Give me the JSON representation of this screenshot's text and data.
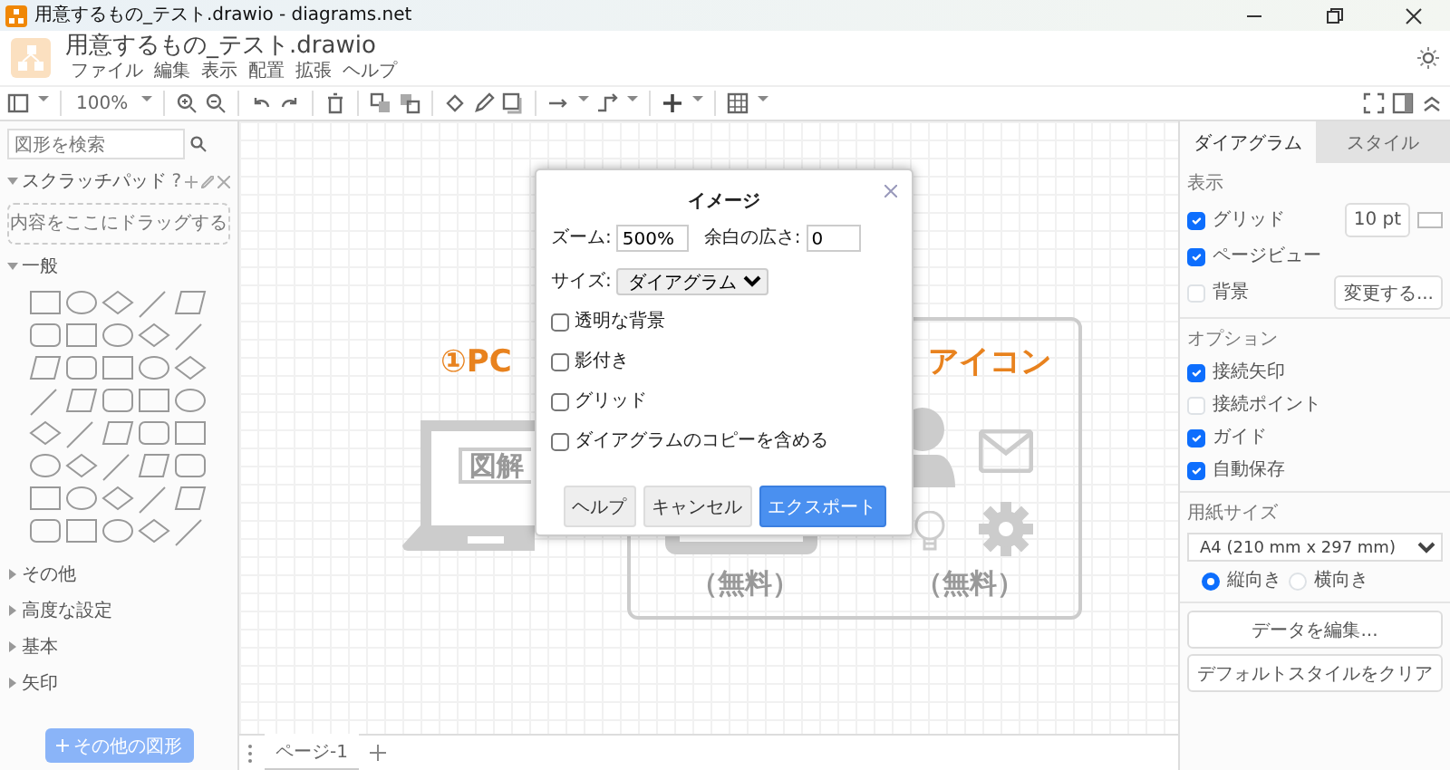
{
  "window": {
    "title": "用意するもの_テスト.drawio - diagrams.net"
  },
  "header": {
    "file_name": "用意するもの_テスト.drawio",
    "menu": [
      "ファイル",
      "編集",
      "表示",
      "配置",
      "拡張",
      "ヘルプ"
    ]
  },
  "toolbar": {
    "zoom": "100%"
  },
  "sidebar": {
    "search": {
      "placeholder": "図形を検索"
    },
    "scratchpad": {
      "title": "スクラッチパッド",
      "expanded": true,
      "help": "?",
      "drop_hint": "内容をここにドラッグする"
    },
    "sections": [
      {
        "label": "一般",
        "expanded": true
      },
      {
        "label": "その他",
        "expanded": false
      },
      {
        "label": "高度な設定",
        "expanded": false
      },
      {
        "label": "基本",
        "expanded": false
      },
      {
        "label": "矢印",
        "expanded": false
      }
    ],
    "more_shapes_button": "その他の図形"
  },
  "canvas": {
    "pc_group": {
      "heading": "①PC",
      "screen_label": "図解"
    },
    "icon_group": {
      "heading": "アイコン",
      "captions": [
        "（無料）",
        "（無料）"
      ]
    }
  },
  "page_tabs": [
    {
      "label": "ページ-1",
      "selected": true
    }
  ],
  "format_panel": {
    "tabs": [
      {
        "label": "ダイアグラム",
        "selected": true
      },
      {
        "label": "スタイル",
        "selected": false
      }
    ],
    "view": {
      "title": "表示",
      "options": [
        {
          "label": "グリッド",
          "checked": true
        },
        {
          "label": "ページビュー",
          "checked": true
        },
        {
          "label": "背景",
          "checked": false
        }
      ],
      "grid_size": "10 pt",
      "background_button": "変更する..."
    },
    "options": {
      "title": "オプション",
      "items": [
        {
          "label": "接続矢印",
          "checked": true
        },
        {
          "label": "接続ポイント",
          "checked": false
        },
        {
          "label": "ガイド",
          "checked": true
        },
        {
          "label": "自動保存",
          "checked": true
        }
      ]
    },
    "paper": {
      "title": "用紙サイズ",
      "value": "A4 (210 mm x 297 mm)",
      "orientations": [
        {
          "label": "縦向き",
          "selected": true
        },
        {
          "label": "横向き",
          "selected": false
        }
      ]
    },
    "buttons": [
      "データを編集...",
      "デフォルトスタイルをクリア"
    ]
  },
  "dialog": {
    "title": "イメージ",
    "zoom": {
      "label": "ズーム:",
      "value": "500%"
    },
    "border": {
      "label": "余白の広さ:",
      "value": "0"
    },
    "size": {
      "label": "サイズ:",
      "value": "ダイアグラム"
    },
    "options": [
      {
        "label": "透明な背景",
        "checked": false
      },
      {
        "label": "影付き",
        "checked": false
      },
      {
        "label": "グリッド",
        "checked": false
      },
      {
        "label": "ダイアグラムのコピーを含める",
        "checked": false
      }
    ],
    "buttons": [
      {
        "label": "ヘルプ",
        "kind": "default"
      },
      {
        "label": "キャンセル",
        "kind": "default"
      },
      {
        "label": "エクスポート",
        "kind": "primary"
      }
    ]
  }
}
